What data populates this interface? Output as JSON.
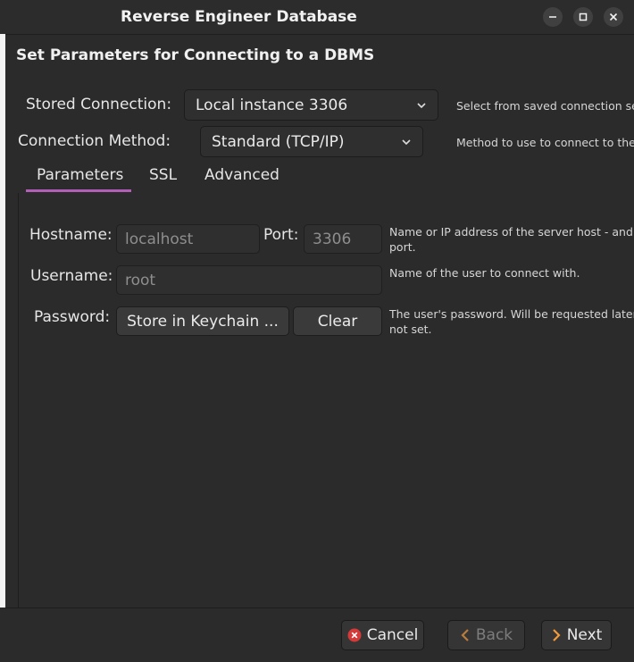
{
  "window": {
    "title": "Reverse Engineer Database",
    "controls": [
      "minimize-icon",
      "maximize-icon",
      "close-icon"
    ]
  },
  "header": {
    "title": "Set Parameters for Connecting to a DBMS"
  },
  "stored_connection": {
    "label": "Stored Connection:",
    "value": "Local instance 3306",
    "help": "Select from saved connection set"
  },
  "connection_method": {
    "label": "Connection Method:",
    "value": "Standard (TCP/IP)",
    "help": "Method to use to connect to the"
  },
  "tabs": [
    {
      "label": "Parameters",
      "active": true
    },
    {
      "label": "SSL",
      "active": false
    },
    {
      "label": "Advanced",
      "active": false
    }
  ],
  "parameters": {
    "hostname": {
      "label": "Hostname:",
      "value": "localhost",
      "help_line1": "Name or IP address of the server host - and T",
      "help_line2": "port."
    },
    "port": {
      "label": "Port:",
      "value": "3306"
    },
    "username": {
      "label": "Username:",
      "value": "root",
      "help": "Name of the user to connect with."
    },
    "password": {
      "label": "Password:",
      "store_button": "Store in Keychain ...",
      "clear_button": "Clear",
      "help_line1": "The user's password. Will be requested later i",
      "help_line2": "not set."
    }
  },
  "footer": {
    "cancel": "Cancel",
    "back": "Back",
    "next": "Next"
  },
  "colors": {
    "accent": "#b35fba",
    "cancel_icon": "#d33a3a",
    "next_icon": "#f29b3a",
    "back_icon": "#b87c3f"
  }
}
